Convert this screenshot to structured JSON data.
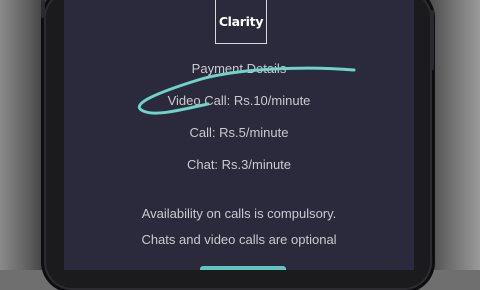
{
  "app": {
    "logo_text": "Clarity"
  },
  "content": {
    "payment_heading": "Payment Details",
    "video_call_rate": "Video Call: Rs.10/minute",
    "call_rate": "Call: Rs.5/minute",
    "chat_rate": "Chat: Rs.3/minute",
    "availability_note": "Availability on calls is compulsory.",
    "optional_note": "Chats and video calls are optional"
  },
  "colors": {
    "screen_background": "#2b2a3d",
    "text": "#c9c9d2",
    "accent_swoosh": "#6fd3c8",
    "button_accent": "#5fc7c0"
  },
  "icons": {
    "annotation": "teal-swoosh-underline"
  }
}
